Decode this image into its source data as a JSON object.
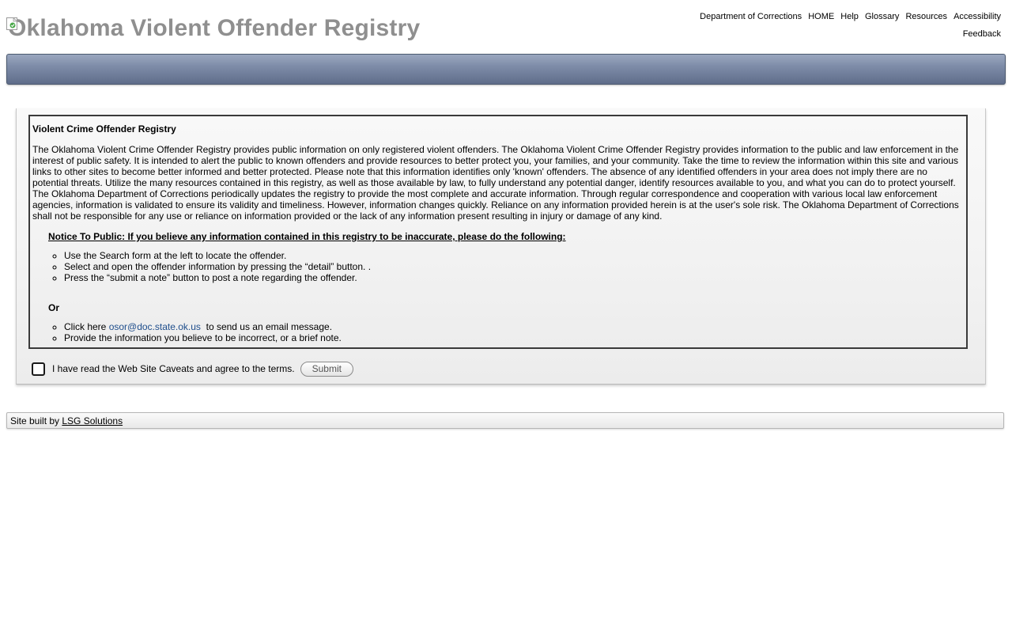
{
  "header": {
    "site_title": "Oklahoma Violent Offender Registry",
    "nav": {
      "department": "Department of Corrections",
      "home": "HOME",
      "help": "Help",
      "glossary": "Glossary",
      "resources": "Resources",
      "accessibility": "Accessibility",
      "feedback": "Feedback"
    }
  },
  "main": {
    "heading": "Violent Crime Offender Registry",
    "paragraph": "The Oklahoma Violent Crime Offender Registry provides public information on only registered violent offenders. The Oklahoma Violent Crime Offender Registry provides information to the public and law enforcement in the interest of public safety. It is intended to alert the public to known offenders and provide resources to better protect you, your families, and your community. Take the time to review the information within this site and various links to other sites to become better informed and better protected. Please note that this information identifies only 'known' offenders. The absence of any identified offenders in your area does not imply there are no potential threats. Utilize the many resources contained in this registry, as well as those available by law, to fully understand any potential danger, identify resources available to you, and what you can do to protect yourself. The Oklahoma Department of Corrections periodically updates the registry to provide the most complete and accurate information. Through regular correspondence and cooperation with various local law enforcement agencies, information is validated to ensure its validity and timeliness. However, information changes quickly. Reliance on any information provided herein is at the user's sole risk. The Oklahoma Department of Corrections shall not be responsible for any use or reliance on information provided or the lack of any information present resulting in injury or damage of any kind.",
    "notice_heading": "Notice To Public: If you believe any information contained in this registry to be inaccurate, please do the following:",
    "steps": [
      "Use the Search form at the left to locate the offender.",
      "Select and open the offender information by pressing the “detail” button. .",
      "Press the “submit a note” button to post a note regarding the offender."
    ],
    "or_label": "Or",
    "email_step": {
      "prefix": "Click here ",
      "email": "osor@doc.state.ok.us",
      "suffix": "  to send us an email message."
    },
    "last_step": "Provide the information you believe to be incorrect, or a brief note.",
    "agree_label": "I have read the Web Site Caveats and agree to the terms.",
    "submit_label": "Submit"
  },
  "footer": {
    "prefix": "Site built by ",
    "link_text": "LSG Solutions"
  },
  "colors": {
    "title_gray": "#8f8f8f",
    "banner_top": "#9aa7bf",
    "banner_bottom": "#5f6d8a",
    "link_blue": "#1f4e8c"
  },
  "icons": {
    "title_image": "broken-image-icon"
  }
}
